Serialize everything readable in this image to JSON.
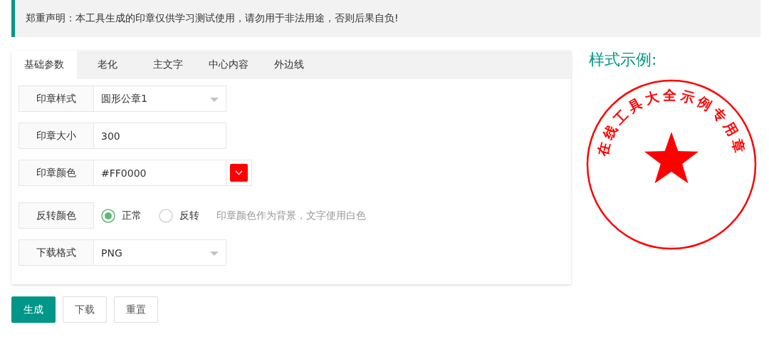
{
  "notice": "郑重声明：本工具生成的印章仅供学习测试使用，请勿用于非法用途，否则后果自负!",
  "tabs": [
    {
      "label": "基础参数",
      "selected": true
    },
    {
      "label": "老化",
      "selected": false
    },
    {
      "label": "主文字",
      "selected": false
    },
    {
      "label": "中心内容",
      "selected": false
    },
    {
      "label": "外边线",
      "selected": false
    }
  ],
  "fields": [
    {
      "kind": "select",
      "label": "印章样式",
      "value": "圆形公章1"
    },
    {
      "kind": "text",
      "label": "印章大小",
      "value": "300"
    },
    {
      "kind": "color",
      "label": "印章颜色",
      "value": "#FF0000",
      "color": "#ff0000"
    },
    {
      "kind": "radio",
      "label": "反转颜色",
      "options": [
        {
          "label": "正常",
          "selected": true
        },
        {
          "label": "反转",
          "selected": false
        }
      ],
      "hint": "印章颜色作为背景，文字使用白色"
    },
    {
      "kind": "select",
      "label": "下载格式",
      "value": "PNG"
    }
  ],
  "buttons": [
    {
      "label": "生成",
      "kind": "primary"
    },
    {
      "label": "下载",
      "kind": "plain"
    },
    {
      "label": "重置",
      "kind": "plain"
    }
  ],
  "preview": {
    "title": "样式示例:",
    "seal_text": "在线工具大全示例专用章",
    "color": "#ff0000"
  }
}
